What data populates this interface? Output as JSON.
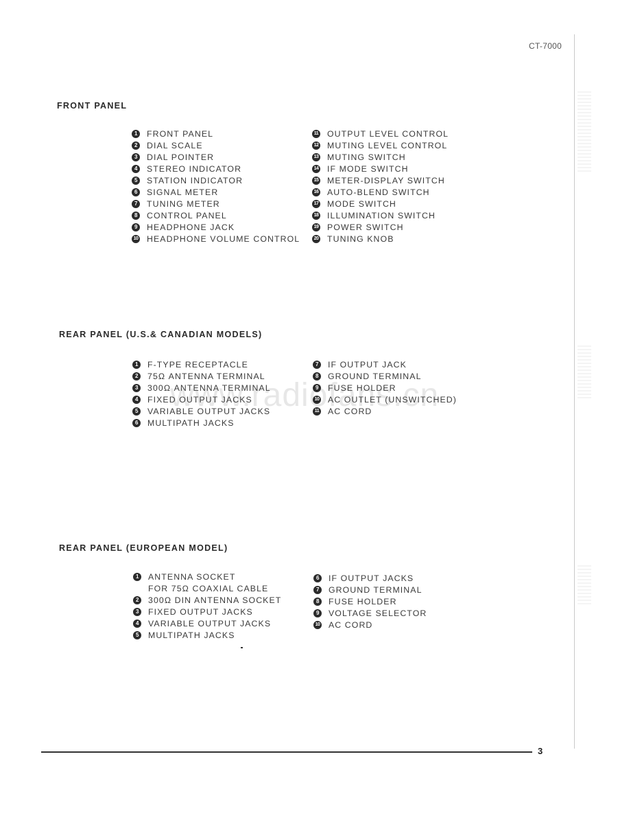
{
  "header": {
    "model": "CT-7000"
  },
  "watermark": "www.radiofans.cn",
  "sections": [
    {
      "title": "FRONT PANEL",
      "columns": [
        [
          {
            "n": "1",
            "label": "FRONT PANEL"
          },
          {
            "n": "2",
            "label": "DIAL SCALE"
          },
          {
            "n": "3",
            "label": "DIAL POINTER"
          },
          {
            "n": "4",
            "label": "STEREO INDICATOR"
          },
          {
            "n": "5",
            "label": "STATION INDICATOR"
          },
          {
            "n": "6",
            "label": "SIGNAL METER"
          },
          {
            "n": "7",
            "label": "TUNING METER"
          },
          {
            "n": "8",
            "label": "CONTROL PANEL"
          },
          {
            "n": "9",
            "label": "HEADPHONE JACK"
          },
          {
            "n": "10",
            "label": "HEADPHONE VOLUME CONTROL"
          }
        ],
        [
          {
            "n": "11",
            "label": "OUTPUT LEVEL CONTROL"
          },
          {
            "n": "12",
            "label": "MUTING LEVEL CONTROL"
          },
          {
            "n": "13",
            "label": "MUTING SWITCH"
          },
          {
            "n": "14",
            "label": "IF MODE SWITCH"
          },
          {
            "n": "15",
            "label": "METER-DISPLAY SWITCH"
          },
          {
            "n": "16",
            "label": "AUTO-BLEND SWITCH"
          },
          {
            "n": "17",
            "label": "MODE SWITCH"
          },
          {
            "n": "18",
            "label": "ILLUMINATION SWITCH"
          },
          {
            "n": "19",
            "label": "POWER SWITCH"
          },
          {
            "n": "20",
            "label": "TUNING KNOB"
          }
        ]
      ]
    },
    {
      "title": "REAR PANEL (U.S.& CANADIAN MODELS)",
      "columns": [
        [
          {
            "n": "1",
            "label": "F-TYPE RECEPTACLE"
          },
          {
            "n": "2",
            "label": "75Ω ANTENNA TERMINAL"
          },
          {
            "n": "3",
            "label": "300Ω ANTENNA TERMINAL"
          },
          {
            "n": "4",
            "label": "FIXED OUTPUT JACKS"
          },
          {
            "n": "5",
            "label": "VARIABLE OUTPUT JACKS"
          },
          {
            "n": "6",
            "label": "MULTIPATH JACKS"
          }
        ],
        [
          {
            "n": "7",
            "label": "IF OUTPUT JACK"
          },
          {
            "n": "8",
            "label": "GROUND TERMINAL"
          },
          {
            "n": "9",
            "label": "FUSE HOLDER"
          },
          {
            "n": "10",
            "label": "AC OUTLET (UNSWITCHED)"
          },
          {
            "n": "11",
            "label": "AC CORD"
          }
        ]
      ]
    },
    {
      "title": "REAR PANEL (EUROPEAN MODEL)",
      "columns": [
        [
          {
            "n": "1",
            "label": "ANTENNA SOCKET"
          },
          {
            "n": "",
            "label": "FOR 75Ω COAXIAL CABLE"
          },
          {
            "n": "2",
            "label": "300Ω DIN ANTENNA SOCKET"
          },
          {
            "n": "3",
            "label": "FIXED OUTPUT JACKS"
          },
          {
            "n": "4",
            "label": "VARIABLE OUTPUT JACKS"
          },
          {
            "n": "5",
            "label": "MULTIPATH JACKS"
          }
        ],
        [
          {
            "n": "6",
            "label": "IF OUTPUT JACKS"
          },
          {
            "n": "7",
            "label": "GROUND TERMINAL"
          },
          {
            "n": "8",
            "label": "FUSE HOLDER"
          },
          {
            "n": "9",
            "label": "VOLTAGE SELECTOR"
          },
          {
            "n": "10",
            "label": "AC CORD"
          }
        ]
      ]
    }
  ],
  "footer": {
    "page_number": "3"
  }
}
